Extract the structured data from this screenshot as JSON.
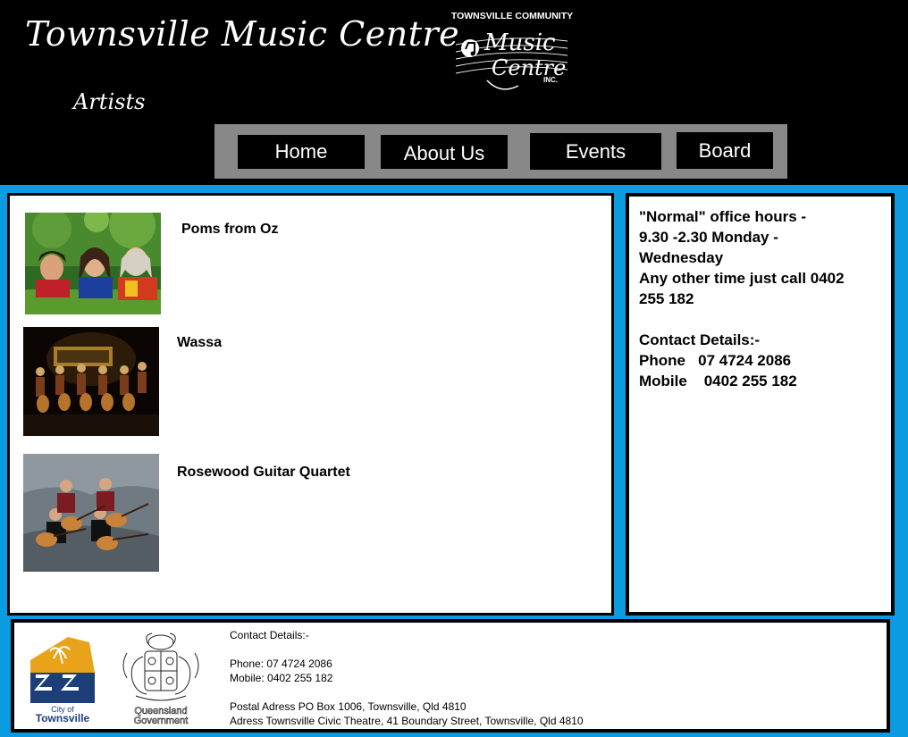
{
  "header": {
    "site_title": "Townsville Music Centre",
    "page_subtitle": "Artists",
    "logo": {
      "top_text": "TOWNSVILLE COMMUNITY",
      "line1": "Music",
      "line2": "Centre",
      "suffix": "INC."
    }
  },
  "nav": {
    "items": [
      {
        "label": "Home"
      },
      {
        "label": "About Us"
      },
      {
        "label": "Events"
      },
      {
        "label": "Board"
      }
    ]
  },
  "artists": [
    {
      "name": "Poms from Oz",
      "photo": "three-performers-photo"
    },
    {
      "name": "Wassa",
      "photo": "drummers-on-stage-photo"
    },
    {
      "name": "Rosewood Guitar Quartet",
      "photo": "guitar-quartet-photo"
    }
  ],
  "sidebar": {
    "lines": [
      "\"Normal\" office hours -",
      "9.30 -2.30 Monday -",
      "Wednesday",
      "Any other time just call 0402",
      "255 182",
      "",
      "Contact Details:-",
      "Phone   07 4724 2086",
      "Mobile    0402 255 182"
    ]
  },
  "footer": {
    "lines": [
      "Contact Details:-",
      "",
      "Phone: 07 4724 2086",
      "Mobile: 0402 255 182",
      "",
      "Postal Adress PO Box 1006, Townsville, Qld 4810",
      "Adress Townsville Civic Theatre, 41 Boundary Street, Townsville, Qld 4810"
    ],
    "city_logo": {
      "line1": "City of",
      "line2": "Townsville"
    },
    "qld_logo": {
      "line1": "Queensland",
      "line2": "Government"
    }
  },
  "colors": {
    "page_background": "#0a9be0",
    "header_background": "#000000",
    "nav_background": "#888888",
    "nav_button": "#000000",
    "text": "#000000",
    "city_logo_gold": "#e8a31b",
    "city_logo_navy": "#1c3f7a"
  }
}
